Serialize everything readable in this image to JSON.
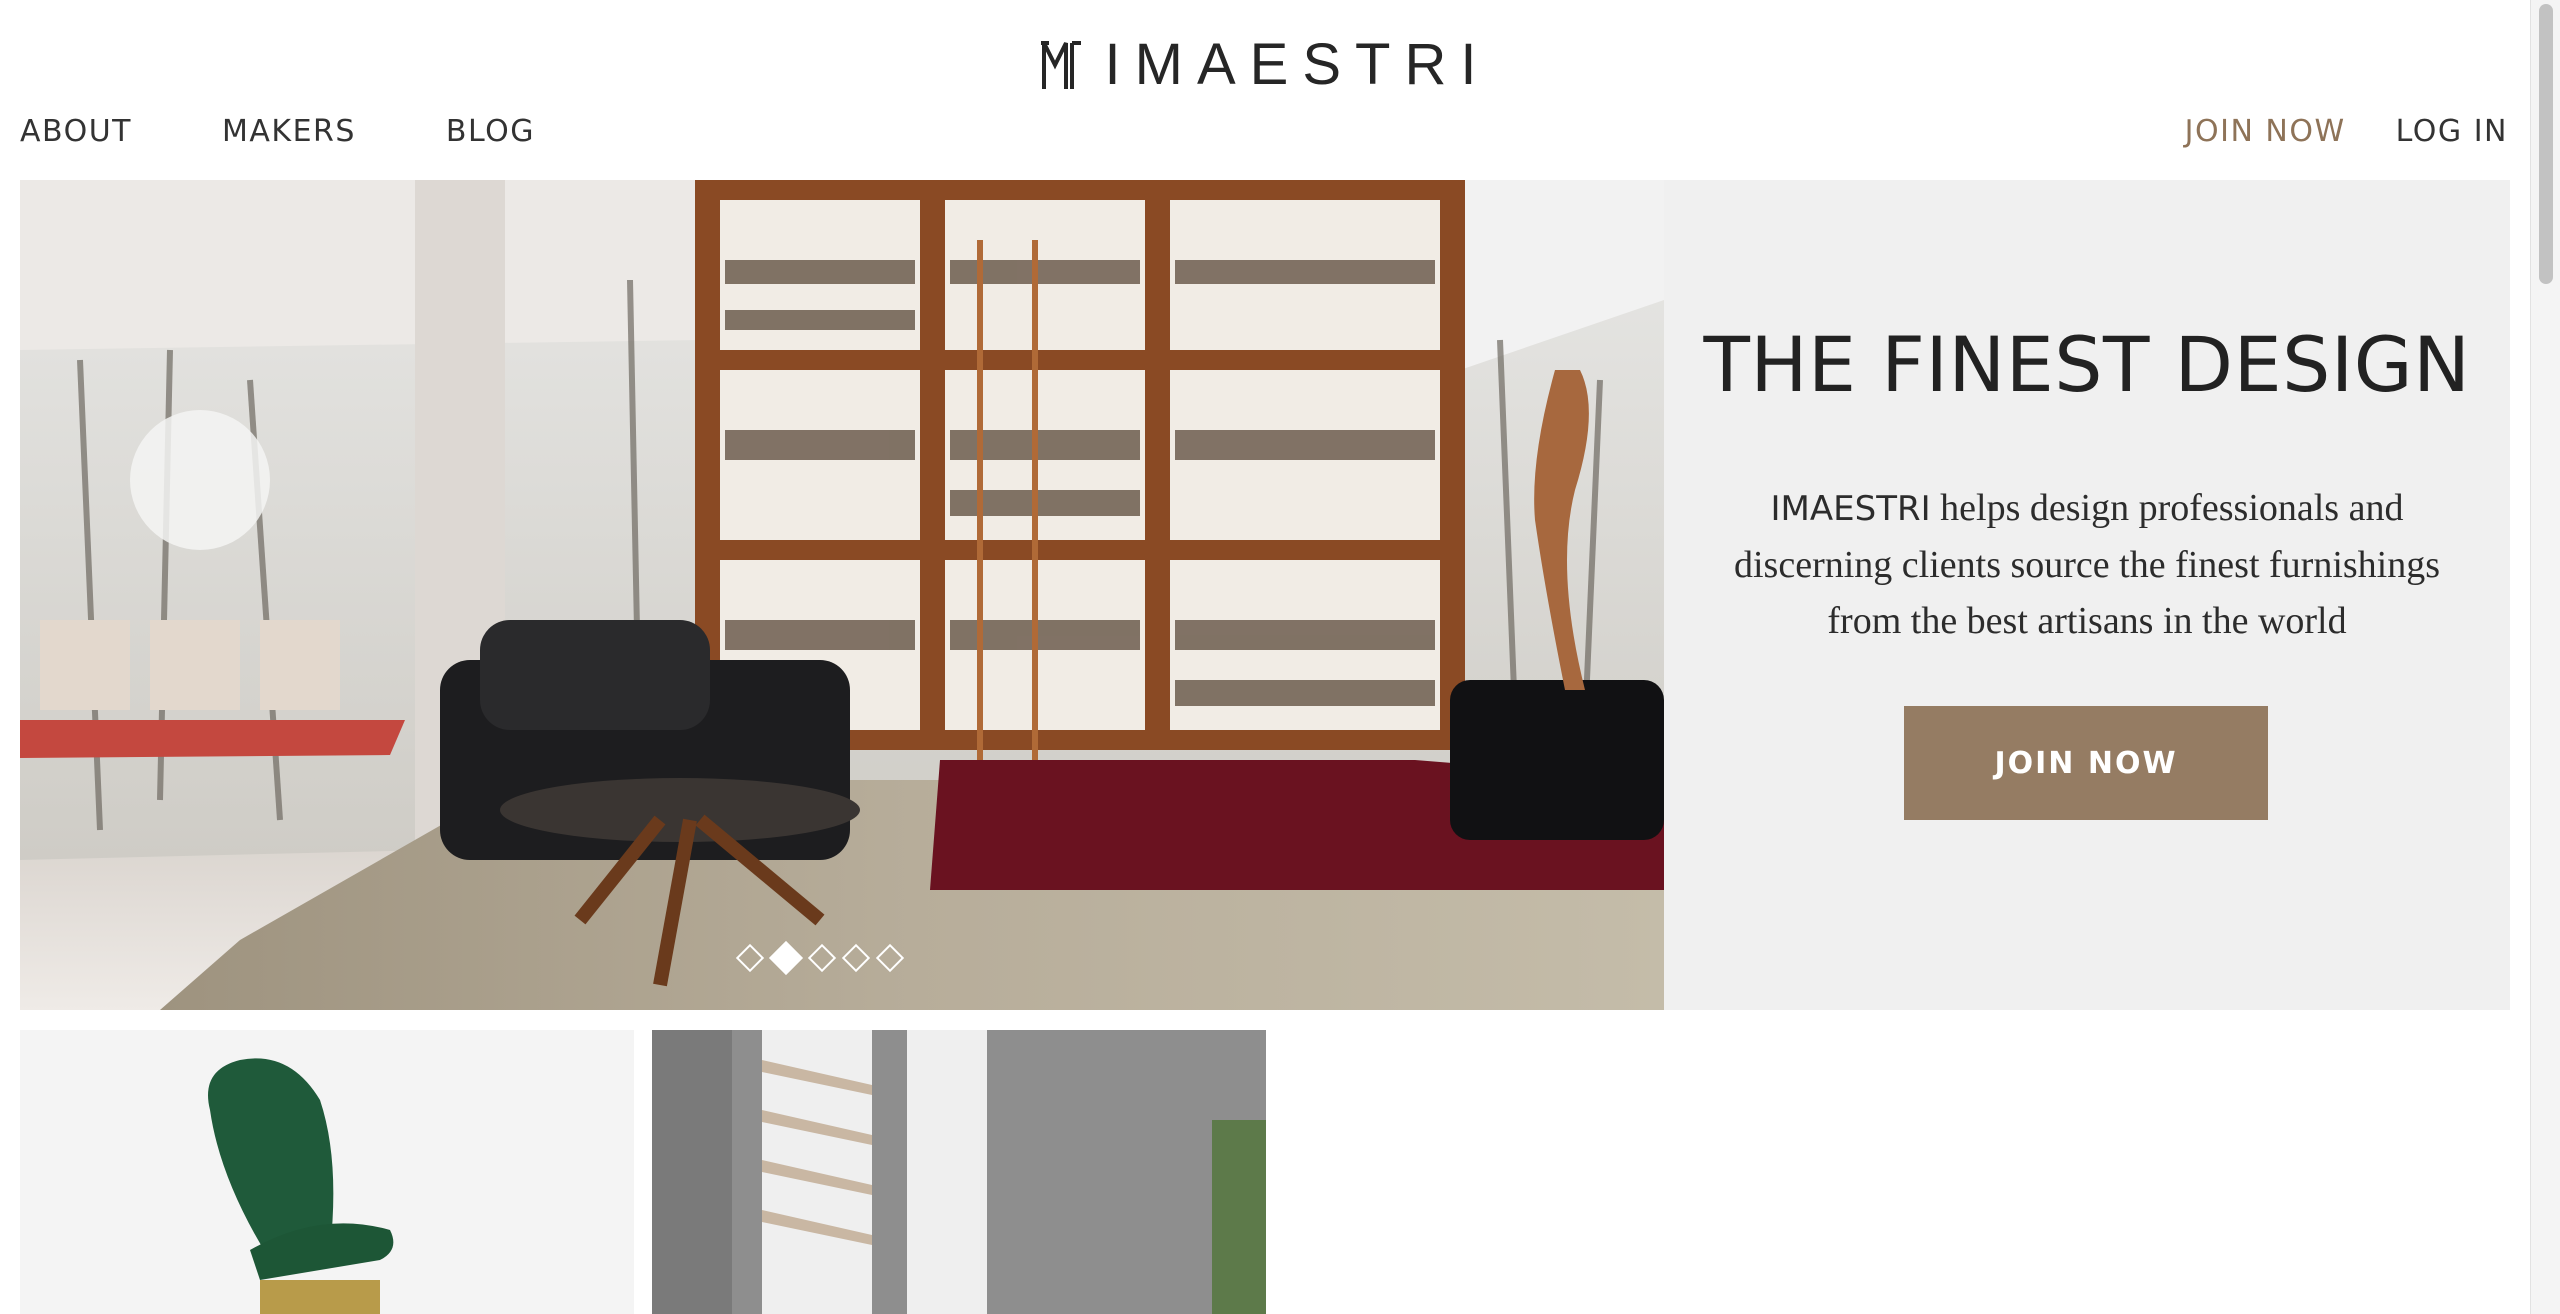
{
  "header": {
    "logo_mark": "logo-monogram-icon",
    "logo_text": "IMAESTRI",
    "nav_left": [
      {
        "label": "ABOUT"
      },
      {
        "label": "MAKERS"
      },
      {
        "label": "BLOG"
      }
    ],
    "nav_right": [
      {
        "label": "JOIN NOW"
      },
      {
        "label": "LOG IN"
      }
    ]
  },
  "hero": {
    "title": "THE FINEST DESIGN",
    "brand": "IMAESTRI",
    "description": " helps design professionals and discerning clients source the finest furnishings from the best artisans in the world",
    "cta_label": "JOIN NOW",
    "slides_total": 5,
    "active_slide": 2
  },
  "colors": {
    "accent": "#957c63",
    "accent_text": "#8e7358",
    "panel_bg": "#f0f0f0",
    "text_dark": "#222222"
  }
}
